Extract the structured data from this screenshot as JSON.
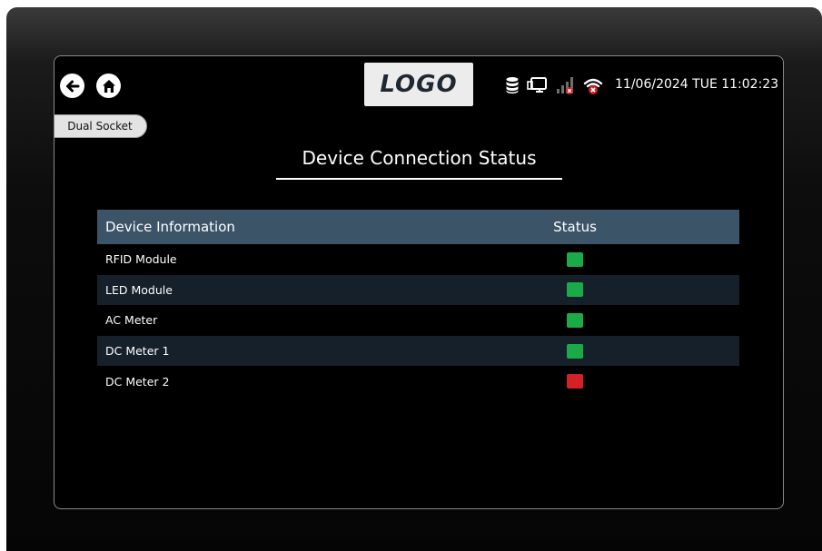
{
  "header": {
    "logo_text": "LOGO",
    "datetime": "11/06/2024 TUE 11:02:23",
    "back_icon": "arrow-left-icon",
    "home_icon": "home-icon",
    "status_icons": [
      "database-icon",
      "network-monitor-icon",
      "cellular-signal-disconnected-icon",
      "wifi-disconnected-icon"
    ]
  },
  "mode_tab": {
    "label": "Dual Socket"
  },
  "page": {
    "title": "Device Connection Status"
  },
  "table": {
    "headers": [
      "Device Information",
      "Status"
    ],
    "rows": [
      {
        "name": "RFID Module",
        "status": "connected"
      },
      {
        "name": "LED Module",
        "status": "connected"
      },
      {
        "name": "AC Meter",
        "status": "connected"
      },
      {
        "name": "DC Meter 1",
        "status": "connected"
      },
      {
        "name": "DC Meter 2",
        "status": "disconnected"
      }
    ]
  },
  "colors": {
    "connected": "#1aaa48",
    "disconnected": "#d62026",
    "header_bg": "#3c5468",
    "alt_row_bg": "#16202a"
  }
}
